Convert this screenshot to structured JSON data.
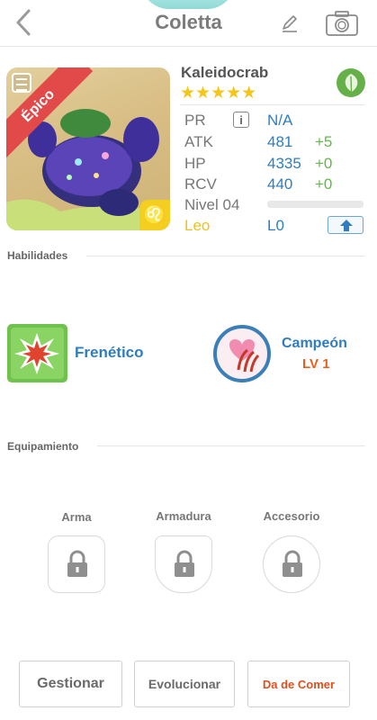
{
  "header": {
    "title": "Coletta",
    "back_icon": "chevron-left-icon",
    "edit_icon": "pencil-icon",
    "camera_icon": "camera-icon"
  },
  "monster": {
    "rarity": "Épico",
    "name": "Kaleidocrab",
    "stars": "★★★★★",
    "element_icon": "leaf-icon",
    "zodiac_symbol": "♌",
    "stats": {
      "pr_label": "PR",
      "pr_value": "N/A",
      "atk_label": "ATK",
      "atk_value": "481",
      "atk_bonus": "+5",
      "hp_label": "HP",
      "hp_value": "4335",
      "hp_bonus": "+0",
      "rcv_label": "RCV",
      "rcv_value": "440",
      "rcv_bonus": "+0",
      "level_label": "Nivel 04",
      "xp_progress": 0
    },
    "zodiac_label": "Leo",
    "rank_label": "L0"
  },
  "skills": {
    "section_title": "Habilidades",
    "skill_name": "Frenético",
    "trait_name": "Campeón",
    "trait_level": "LV 1"
  },
  "equipment": {
    "section_title": "Equipamiento",
    "slots": [
      {
        "label": "Arma"
      },
      {
        "label": "Armadura"
      },
      {
        "label": "Accesorio"
      }
    ]
  },
  "actions": {
    "manage": "Gestionar",
    "evolve": "Evolucionar",
    "feed": "Da de Comer"
  },
  "colors": {
    "accent_blue": "#2f7dbf",
    "bonus_green": "#62b84a",
    "gold": "#efc21a",
    "epic_red": "#e24a4a",
    "feed_orange": "#e14f1c"
  }
}
